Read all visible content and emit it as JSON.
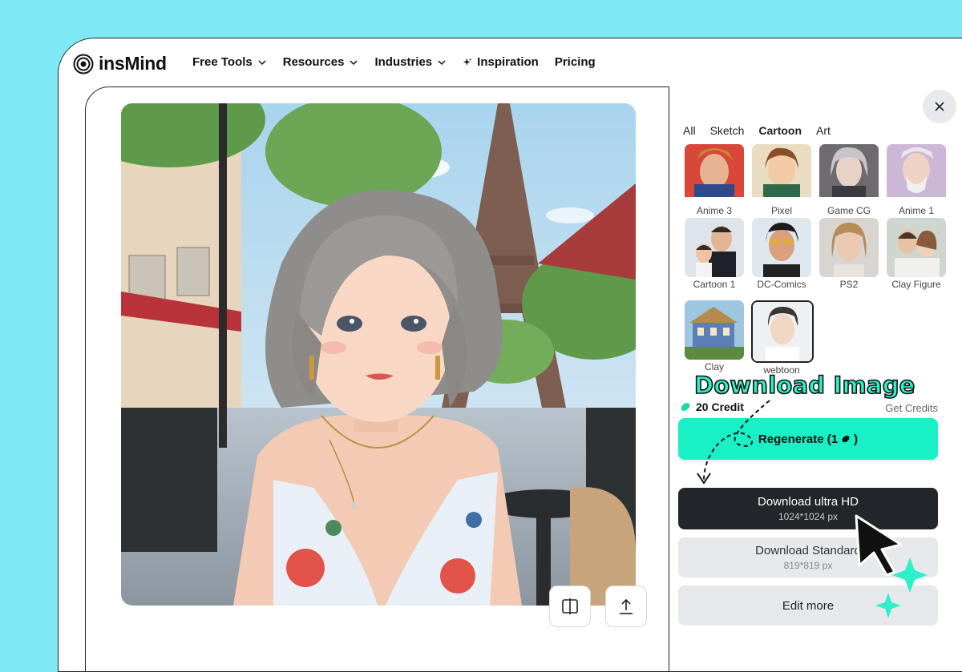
{
  "brand": {
    "name": "insMind"
  },
  "nav": {
    "free_tools": "Free Tools",
    "resources": "Resources",
    "industries": "Industries",
    "inspiration": "Inspiration",
    "pricing": "Pricing"
  },
  "side_panel": {
    "tabs": [
      {
        "label": "All",
        "active": false
      },
      {
        "label": "Sketch",
        "active": false
      },
      {
        "label": "Cartoon",
        "active": true
      },
      {
        "label": "Art",
        "active": false
      }
    ],
    "styles": [
      {
        "label": "Anime 3"
      },
      {
        "label": "Pixel"
      },
      {
        "label": "Game CG"
      },
      {
        "label": "Anime 1"
      },
      {
        "label": "Cartoon 1"
      },
      {
        "label": "DC-Comics"
      },
      {
        "label": "PS2"
      },
      {
        "label": "Clay Figure"
      },
      {
        "label": "Clay"
      },
      {
        "label": "webtoon",
        "selected": true
      }
    ],
    "credits": "20 Credit",
    "get_credits": "Get Credits",
    "regenerate": "Regenerate (1",
    "regenerate_suffix": ")",
    "download_ultra": {
      "label": "Download ultra HD",
      "size": "1024*1024 px"
    },
    "download_standard": {
      "label": "Download Standard",
      "size": "819*819 px"
    },
    "edit_more": "Edit more"
  },
  "callout": {
    "text": "Download Image"
  },
  "colors": {
    "accent": "#18f0c6",
    "background": "#7ee8f4",
    "dark_button": "#23262b"
  }
}
